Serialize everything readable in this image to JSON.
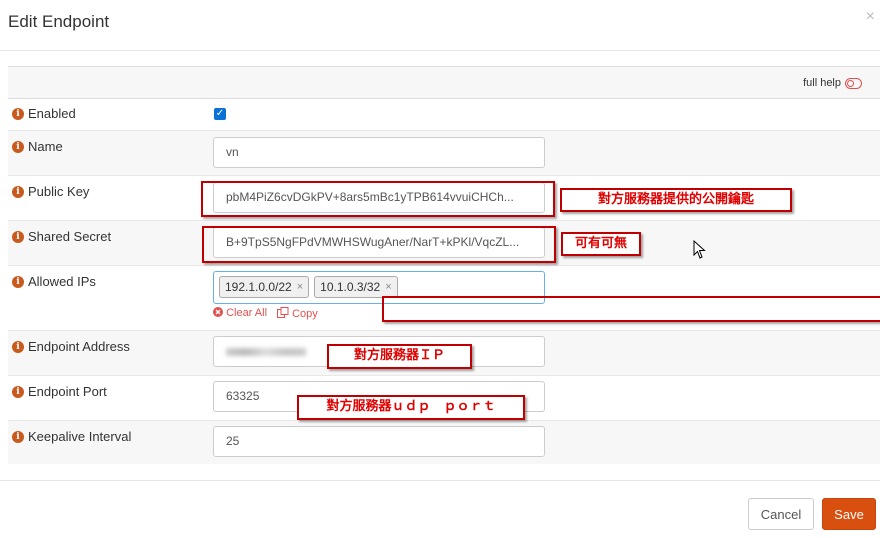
{
  "dialog": {
    "title": "Edit Endpoint",
    "close_symbol": "×"
  },
  "help": {
    "full_help_label": "full help"
  },
  "fields": {
    "enabled": {
      "label": "Enabled",
      "checked": true,
      "check_symbol": "✓"
    },
    "name": {
      "label": "Name",
      "value": "vn"
    },
    "public_key": {
      "label": "Public Key",
      "value": "pbM4PiZ6cvDGkPV+8ars5mBc1yTPB614vvuiCHCh..."
    },
    "shared_secret": {
      "label": "Shared Secret",
      "value": "B+9TpS5NgFPdVMWHSWugAner/NarT+kPKl/VqcZL..."
    },
    "allowed_ips": {
      "label": "Allowed IPs",
      "tags": [
        "192.1.0.0/22",
        "10.1.0.3/32"
      ],
      "tag_remove_symbol": "×",
      "clear_all_label": "Clear All",
      "copy_label": "Copy"
    },
    "endpoint_address": {
      "label": "Endpoint Address"
    },
    "endpoint_port": {
      "label": "Endpoint Port",
      "value": "63325"
    },
    "keepalive_interval": {
      "label": "Keepalive Interval",
      "value": "25"
    }
  },
  "annotations": {
    "public_key_note": "對方服務器提供的公開鑰匙",
    "shared_secret_note": "可有可無",
    "endpoint_address_note": "對方服務器ＩＰ",
    "endpoint_port_note": "對方服務器ｕｄｐ　ｐｏｒｔ"
  },
  "footer": {
    "cancel_label": "Cancel",
    "save_label": "Save"
  },
  "colors": {
    "accent": "#d94f0f",
    "checkbox": "#0a72d6",
    "annotation": "#c00000",
    "info_icon": "#c75a1c"
  }
}
